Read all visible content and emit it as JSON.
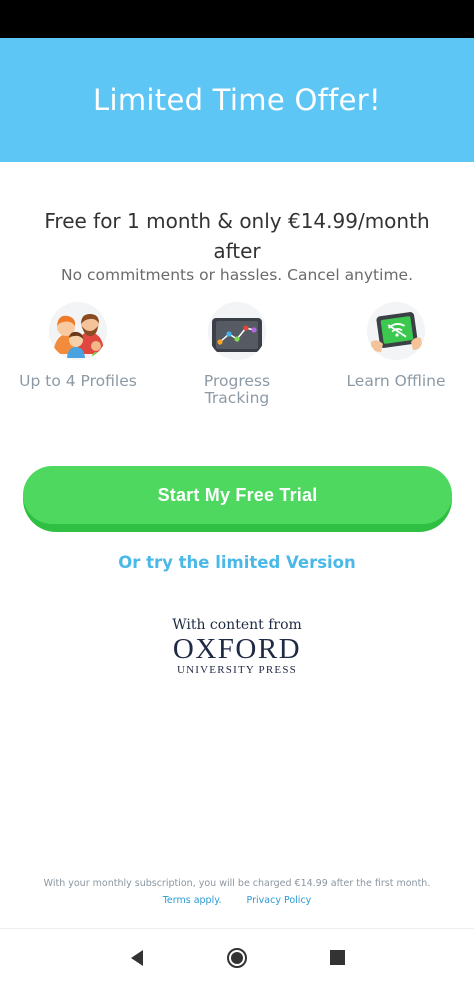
{
  "header": {
    "title": "Limited Time Offer!"
  },
  "offer": {
    "headline": "Free for 1 month & only €14.99/month after",
    "subtitle": "No commitments or hassles. Cancel anytime."
  },
  "features": [
    {
      "label": "Up to 4 Profiles",
      "icon": "family-profiles-icon"
    },
    {
      "label": "Progress Tracking",
      "icon": "progress-chart-tablet-icon"
    },
    {
      "label": "Learn Offline",
      "icon": "offline-tablet-icon"
    }
  ],
  "cta": {
    "label": "Start My Free Trial"
  },
  "secondary": {
    "label": "Or try the limited Version"
  },
  "partner": {
    "with_content": "With content from",
    "name": "OXFORD",
    "press": "UNIVERSITY PRESS"
  },
  "footer": {
    "note": "With your monthly subscription, you will be charged €14.99 after the first month.",
    "terms": "Terms apply.",
    "privacy": "Privacy Policy"
  },
  "colors": {
    "header_bg": "#5ec6f5",
    "cta_green": "#4ed860",
    "link_blue": "#4bb9e8"
  }
}
